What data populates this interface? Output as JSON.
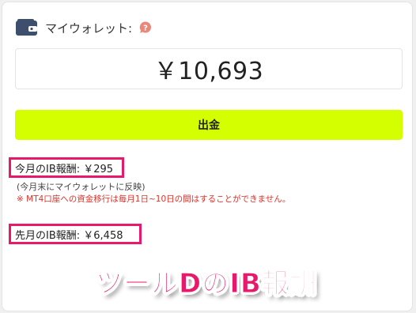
{
  "wallet": {
    "label": "マイウォレット:",
    "balance": "￥10,693",
    "help_glyph": "?"
  },
  "withdraw_button": {
    "label": "出金"
  },
  "ib_rewards": {
    "this_month": "今月のIB報酬: ￥295",
    "this_month_note": "(今月末にマイウォレットに反映)",
    "warning": "※ MT4口座への資金移行は毎月1日~10日の間はすることができません。",
    "last_month": "先月のIB報酬: ￥6,458"
  },
  "overlay": {
    "title": "ツールDのIB報酬"
  },
  "colors": {
    "accent": "#d4ff00",
    "highlight": "#e8196b",
    "warning": "#e0322a",
    "icon": "#3e4f6e",
    "help": "#e9877b"
  }
}
